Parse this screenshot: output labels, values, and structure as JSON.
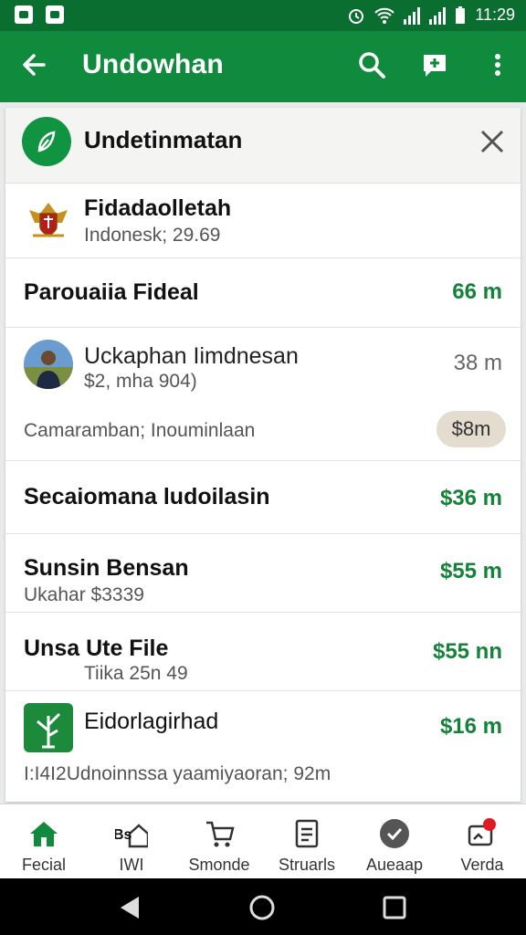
{
  "status": {
    "time": "11:29"
  },
  "appbar": {
    "title": "Undowhan"
  },
  "card": {
    "title": "Undetinmatan",
    "rows": [
      {
        "name": "Fidadaolletah",
        "sub": "Indonesk; 29.69",
        "amount": ""
      },
      {
        "name": "Parouaiia Fideal",
        "sub": "",
        "amount": "66 m"
      },
      {
        "name": "Uckaphan Iimdnesan",
        "sub": "$2, mha 904)",
        "amount": "38 m"
      },
      {
        "name": "",
        "sub": "Camaramban; Inouminlaan",
        "amount": "$8m"
      },
      {
        "name": "Secaiomana ludoilasin",
        "sub": "",
        "amount": "$36 m"
      },
      {
        "name": "Sunsin Bensan",
        "sub": "Ukahar $3339",
        "amount": "$55 m"
      },
      {
        "name": "Unsa Ute File",
        "sub": "Tiika 25n 49",
        "amount": "$55 nn"
      },
      {
        "name": "Eidorlagirhad",
        "sub": "I:I4I2Udnoinnssa yaamiyaoran; 92m",
        "amount": "$16 m"
      }
    ]
  },
  "nav": [
    {
      "label": "Fecial",
      "icon": "home-icon"
    },
    {
      "label": "IWI",
      "icon": "bs-home-icon",
      "icon_text": "Bs"
    },
    {
      "label": "Smonde",
      "icon": "cart-icon"
    },
    {
      "label": "Struarls",
      "icon": "document-icon"
    },
    {
      "label": "Aueaap",
      "icon": "check-circle-icon"
    },
    {
      "label": "Verda",
      "icon": "notification-icon"
    }
  ],
  "colors": {
    "primary": "#108a3c",
    "statusbar": "#0b6e31",
    "amount": "#15823a",
    "pill": "#e3dccf"
  }
}
